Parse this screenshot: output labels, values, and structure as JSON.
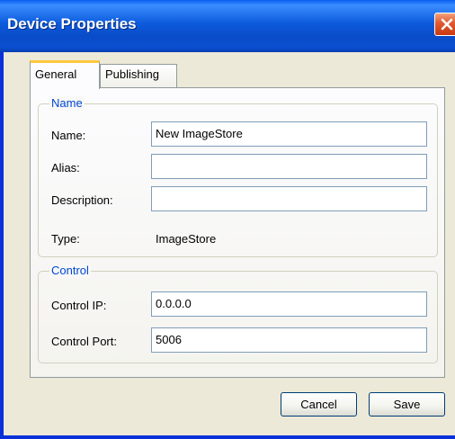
{
  "window": {
    "title": "Device Properties",
    "colors": {
      "titlebar": "#0b4fd0",
      "close": "#e1582f",
      "face": "#ece9d8",
      "legend": "#0046d5"
    }
  },
  "tabs": [
    {
      "label": "General",
      "selected": true
    },
    {
      "label": "Publishing",
      "selected": false
    }
  ],
  "name_group": {
    "legend": "Name",
    "name_label": "Name:",
    "name_value": "New ImageStore",
    "alias_label": "Alias:",
    "alias_value": "",
    "description_label": "Description:",
    "description_value": "",
    "type_label": "Type:",
    "type_value": "ImageStore"
  },
  "control_group": {
    "legend": "Control",
    "ip_label": "Control IP:",
    "ip_value": "0.0.0.0",
    "port_label": "Control Port:",
    "port_value": "5006"
  },
  "buttons": {
    "cancel": "Cancel",
    "save": "Save"
  },
  "icons": {
    "close": "close-icon"
  }
}
